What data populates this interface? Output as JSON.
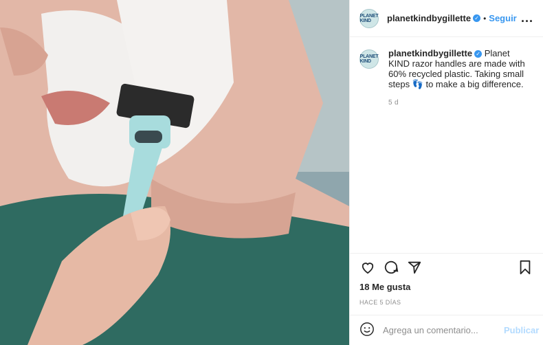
{
  "post": {
    "photo_alt": "",
    "header": {
      "avatar_text": "PLANET KIND",
      "username": "planetkindbygillette",
      "separator": "•",
      "follow_label": "Seguir",
      "more_label": "..."
    },
    "caption": {
      "username": "planetkindbygillette",
      "text": "Planet KIND razor handles are made with 60% recycled plastic. Taking small steps 👣 to make a big difference.",
      "time": "5 d"
    },
    "likes": "18 Me gusta",
    "posted_ago": "HACE 5 DÍAS",
    "comment": {
      "placeholder": "Agrega un comentario...",
      "publish_label": "Publicar"
    },
    "colors": {
      "accent": "#3897f0",
      "muted": "#8e8e8e",
      "shirt": "#2f6b61",
      "razor": "#a8dcdd"
    }
  }
}
